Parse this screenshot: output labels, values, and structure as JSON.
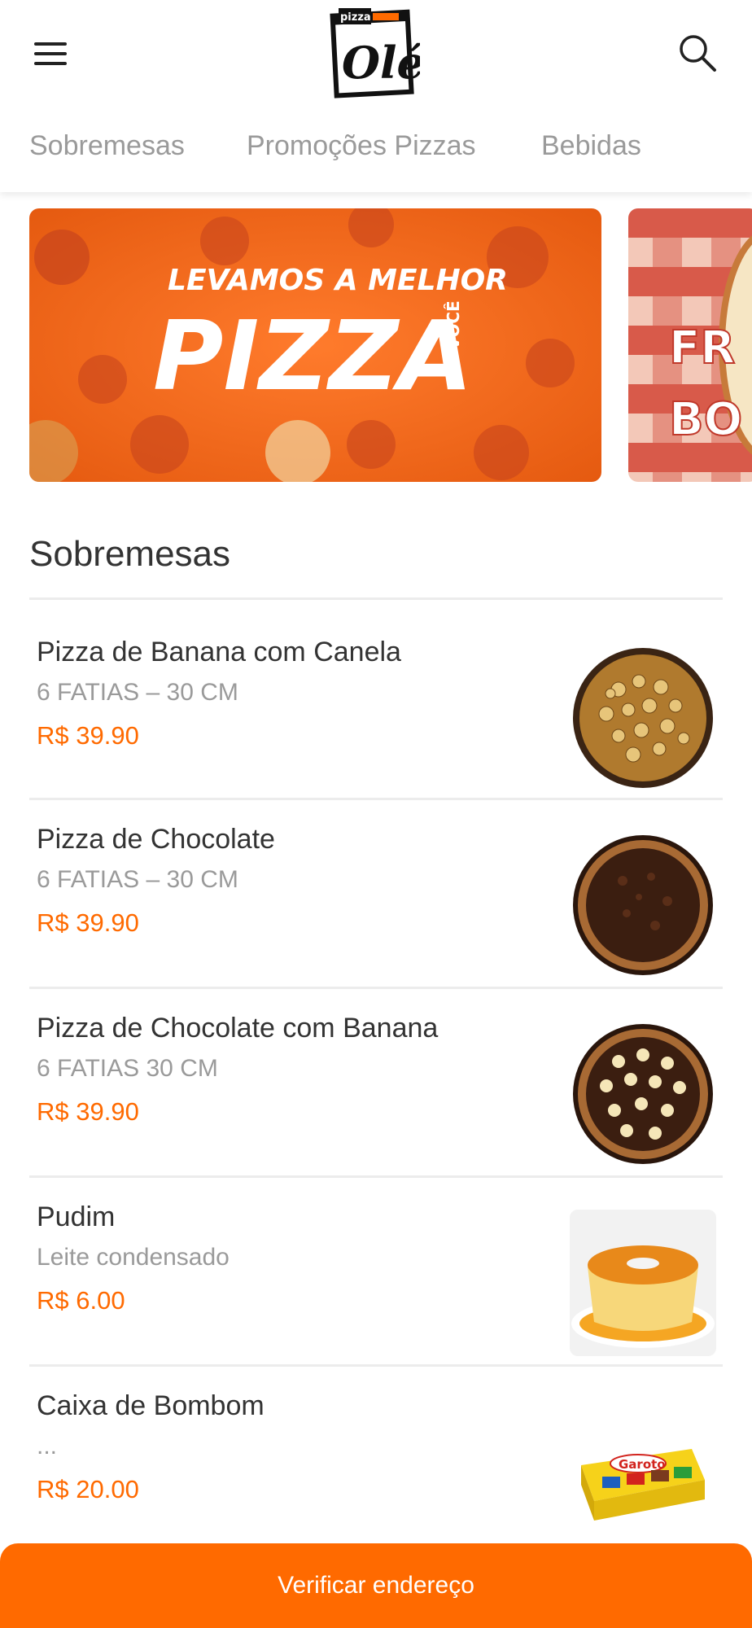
{
  "header": {
    "logo_small_text": "pizza",
    "logo_text": "Olé"
  },
  "tabs": [
    {
      "label": "Sobremesas"
    },
    {
      "label": "Promoções Pizzas"
    },
    {
      "label": "Bebidas"
    }
  ],
  "banners": [
    {
      "line1": "LEVAMOS A MELHOR",
      "line2": "PIZZA",
      "side": "ATÉ VOCÊ"
    },
    {
      "line1": "FR",
      "line2": "BO"
    }
  ],
  "section": {
    "title": "Sobremesas"
  },
  "items": [
    {
      "name": "Pizza de Banana com Canela",
      "desc": "6 FATIAS – 30 CM",
      "price": "R$ 39.90"
    },
    {
      "name": "Pizza de Chocolate",
      "desc": "6 FATIAS – 30 CM",
      "price": "R$ 39.90"
    },
    {
      "name": "Pizza de Chocolate com Banana",
      "desc": "6 FATIAS 30 CM",
      "price": "R$ 39.90"
    },
    {
      "name": "Pudim",
      "desc": "Leite condensado",
      "price": "R$ 6.00"
    },
    {
      "name": "Caixa de Bombom",
      "desc": "...",
      "price": "R$ 20.00",
      "box_brand": "Garoto"
    }
  ],
  "cta": {
    "label": "Verificar endereço"
  },
  "colors": {
    "accent": "#ff6a00",
    "text": "#333333",
    "muted": "#9a9a9a"
  }
}
